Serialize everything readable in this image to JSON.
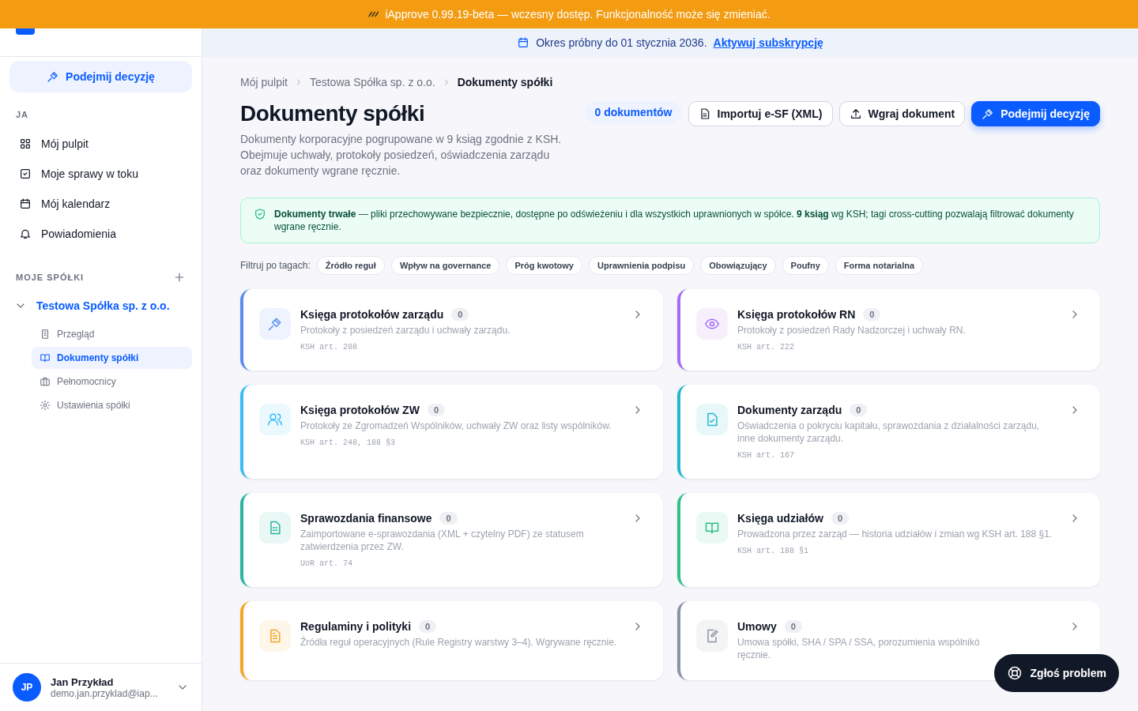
{
  "banner": {
    "text": "iApprove 0.99.19-beta — wczesny dostęp. Funkcjonalność może się zmieniać."
  },
  "sidebar": {
    "primary_button": "Podejmij decyzję",
    "sections": [
      {
        "title": "JA",
        "items": [
          {
            "label": "Mój pulpit",
            "selected": false
          },
          {
            "label": "Moje sprawy w toku",
            "selected": false
          },
          {
            "label": "Mój kalendarz",
            "selected": false
          },
          {
            "label": "Powiadomienia",
            "selected": false
          }
        ]
      }
    ],
    "companies": {
      "title": "MOJE SPÓŁKI",
      "company": {
        "label": "Testowa Spółka sp. z o.o.",
        "expanded": true,
        "children": [
          {
            "label": "Przegląd",
            "selected": false
          },
          {
            "label": "Dokumenty spółki",
            "selected": true
          },
          {
            "label": "Pełnomocnicy",
            "selected": false
          },
          {
            "label": "Ustawienia spółki",
            "selected": false
          }
        ]
      }
    },
    "user": {
      "initials": "JP",
      "name": "Jan Przykład",
      "email": "demo.jan.przyklad@iap..."
    }
  },
  "trial_bar": {
    "text": "Okres próbny do 01 stycznia 2036.",
    "link": "Aktywuj subskrypcję"
  },
  "breadcrumb": [
    "Mój pulpit",
    "Testowa Spółka sp. z o.o.",
    "Dokumenty spółki"
  ],
  "page": {
    "title": "Dokumenty spółki",
    "description": "Dokumenty korporacyjne pogrupowane w 9 ksiąg zgodnie z KSH. Obejmuje uchwały, protokoły posiedzeń, oświadczenia zarządu oraz dokumenty wgrane ręcznie.",
    "count_badge": "0 dokumentów",
    "buttons": [
      {
        "label": "Importuj e-SF (XML)",
        "kind": "secondary"
      },
      {
        "label": "Wgraj dokument",
        "kind": "secondary"
      },
      {
        "label": "Podejmij decyzję",
        "kind": "primary"
      }
    ]
  },
  "notice": {
    "text": "**Dokumenty trwałe** — pliki przechowywane bezpiecznie, dostępne po odświeżeniu i dla wszystkich uprawnionych w spółce. **9 ksiąg** wg KSH; tagi cross-cutting pozwalają filtrować dokumenty wgrane ręcznie."
  },
  "filters": {
    "label": "Filtruj po tagach:",
    "tags": [
      {
        "label": "Źródło reguł",
        "selected": false
      },
      {
        "label": "Wpływ na governance",
        "selected": false
      },
      {
        "label": "Próg kwotowy",
        "selected": false
      },
      {
        "label": "Uprawnienia podpisu",
        "selected": false
      },
      {
        "label": "Obowiązujący",
        "selected": false
      },
      {
        "label": "Poufny",
        "selected": false
      },
      {
        "label": "Forma notarialna",
        "selected": false
      }
    ]
  },
  "books": [
    {
      "title": "Księga protokołów zarządu",
      "count": "0",
      "description": "Protokoły z posiedzeń zarządu i uchwały zarządu.",
      "reference": "KSH art. 208",
      "color": "#5b8def"
    },
    {
      "title": "Księga protokołów RN",
      "count": "0",
      "description": "Protokoły z posiedzeń Rady Nadzorczej i uchwały RN.",
      "reference": "KSH art. 222",
      "color": "#a56cf0"
    },
    {
      "title": "Księga protokołów ZW",
      "count": "0",
      "description": "Protokoły ze Zgromadzeń Wspólników, uchwały ZW oraz listy wspólników.",
      "reference": "KSH art. 248, 188 §3",
      "color": "#38bdf8"
    },
    {
      "title": "Dokumenty zarządu",
      "count": "0",
      "description": "Oświadczenia o pokryciu kapitału, sprawozdania z działalności zarządu, inne dokumenty zarządu.",
      "reference": "KSH art. 167",
      "color": "#22b8cf"
    },
    {
      "title": "Sprawozdania finansowe",
      "count": "0",
      "description": "Zaimportowane e-sprawozdania (XML + czytelny PDF) ze statusem zatwierdzenia przez ZW.",
      "reference": "UoR art. 74",
      "color": "#2bb5a0"
    },
    {
      "title": "Księga udziałów",
      "count": "0",
      "description": "Prowadzona przez zarząd — historia udziałów i zmian wg KSH art. 188 §1.",
      "reference": "KSH art. 188 §1",
      "color": "#34c08a"
    },
    {
      "title": "Regulaminy i polityki",
      "count": "0",
      "description": "Źródła reguł operacyjnych (Rule Registry warstwy 3–4). Wgrywane ręcznie.",
      "color": "#f5a524"
    },
    {
      "title": "Umowy",
      "count": "0",
      "description": "Umowa spółki, SHA / SPA / SSA, porozumienia wspólnikó",
      "description_2": "ręcznie.",
      "color": "#8a94a6"
    }
  ],
  "report_button": "Zgłoś problem"
}
